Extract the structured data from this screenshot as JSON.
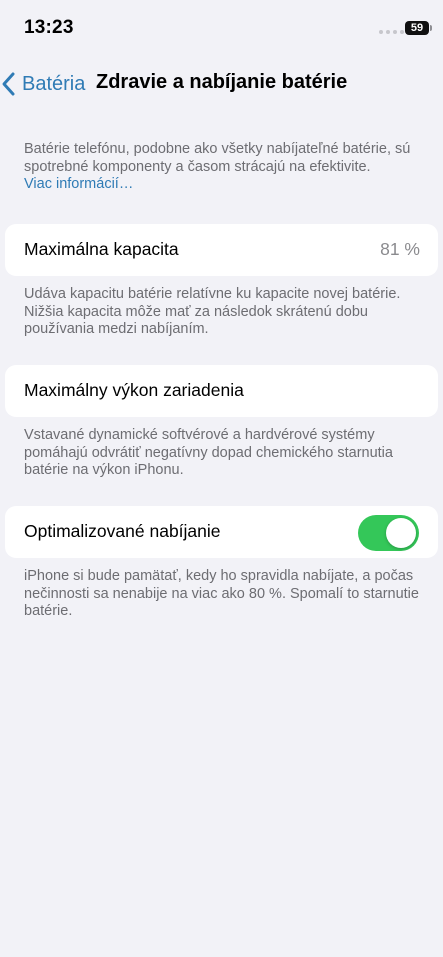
{
  "status_bar": {
    "time": "13:23",
    "battery_level": "59"
  },
  "nav": {
    "back_label": "Batéria",
    "title": "Zdravie a nabíjanie batérie"
  },
  "intro": {
    "text": "Batérie telefónu, podobne ako všetky nabíjateľné batérie, sú spotrebné komponenty a časom strácajú na efektivite.",
    "link": "Viac informácií…"
  },
  "max_capacity": {
    "label": "Maximálna kapacita",
    "value": "81 %",
    "footnote": "Udáva kapacitu batérie relatívne ku kapacite novej batérie. Nižšia kapacita môže mať za následok skrátenú dobu používania medzi nabíjaním."
  },
  "peak_performance": {
    "label": "Maximálny výkon zariadenia",
    "footnote": "Vstavané dynamické softvérové a hardvérové systémy pomáhajú odvrátiť negatívny dopad chemického starnutia batérie na výkon iPhonu."
  },
  "optimized_charging": {
    "label": "Optimalizované nabíjanie",
    "enabled": true,
    "footnote": "iPhone si bude pamätať, kedy ho spravidla nabíjate, a počas nečinnosti sa nenabije na viac ako 80 %. Spomalí to starnutie batérie."
  },
  "colors": {
    "accent": "#2f7bb5",
    "toggle_on": "#34c759",
    "background": "#f2f2f7"
  }
}
